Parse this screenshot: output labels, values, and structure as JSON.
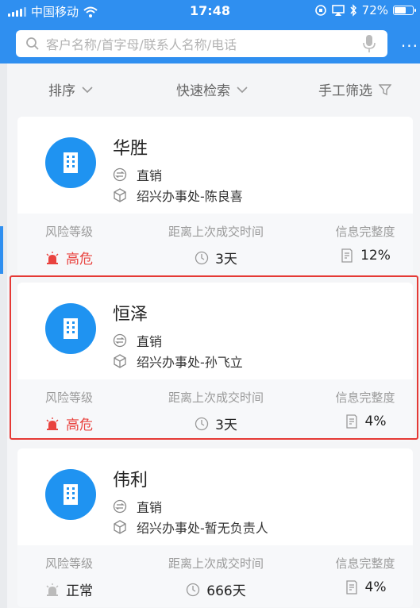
{
  "status_bar": {
    "carrier": "中国移动",
    "time": "17:48",
    "battery": "72%",
    "battery_level": 0.72
  },
  "search": {
    "placeholder": "客户名称/首字母/联系人名称/电话",
    "more_label": "···"
  },
  "filters": [
    {
      "label": "排序",
      "icon": "chevron-down-icon"
    },
    {
      "label": "快速检索",
      "icon": "chevron-down-icon"
    },
    {
      "label": "手工筛选",
      "icon": "funnel-icon"
    }
  ],
  "columns": {
    "risk": "风险等级",
    "last_deal": "距离上次成交时间",
    "completeness": "信息完整度"
  },
  "colors": {
    "primary": "#2f8ff0",
    "avatar": "#1f93f1",
    "danger": "#e9433f",
    "highlight": "#e53935"
  },
  "customers": [
    {
      "name": "华胜",
      "channel": "直销",
      "office": "绍兴办事处-陈良喜",
      "risk": "高危",
      "risk_level": "high",
      "days": "3天",
      "completeness": "12%"
    },
    {
      "name": "恒泽",
      "channel": "直销",
      "office": "绍兴办事处-孙飞立",
      "risk": "高危",
      "risk_level": "high",
      "days": "3天",
      "completeness": "4%",
      "highlighted": true
    },
    {
      "name": "伟利",
      "channel": "直销",
      "office": "绍兴办事处-暂无负责人",
      "risk": "正常",
      "risk_level": "normal",
      "days": "666天",
      "completeness": "4%"
    }
  ]
}
